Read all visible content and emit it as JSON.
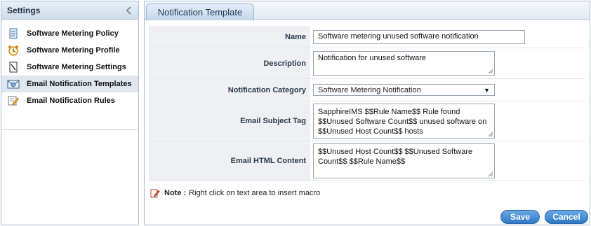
{
  "sidebar": {
    "title": "Settings",
    "collapse_icon": "chevron-left-icon",
    "items": [
      {
        "label": "Software Metering Policy",
        "icon": "policy-document-icon",
        "active": false
      },
      {
        "label": "Software Metering Profile",
        "icon": "alarm-clock-icon",
        "active": false
      },
      {
        "label": "Software Metering Settings",
        "icon": "settings-page-icon",
        "active": false
      },
      {
        "label": "Email Notification Templates",
        "icon": "email-template-icon",
        "active": true
      },
      {
        "label": "Email Notification Rules",
        "icon": "edit-rules-icon",
        "active": false
      }
    ]
  },
  "main": {
    "tab_label": "Notification Template",
    "form": {
      "name_label": "Name",
      "name_value": "Software metering unused software notification",
      "description_label": "Description",
      "description_value": "Notification for unused software",
      "category_label": "Notification Category",
      "category_value": "Software Metering Notification",
      "subject_label": "Email Subject Tag",
      "subject_value": "SapphireIMS  $$Rule Name$$ Rule found $$Unused Software Count$$ unused software on $$Unused Host Count$$ hosts",
      "html_label": "Email HTML Content",
      "html_value": "$$Unused Host Count$$  $$Unused Software Count$$ $$Rule Name$$"
    },
    "note_label": "Note :",
    "note_text": "Right click on text area to insert macro",
    "save_label": "Save",
    "cancel_label": "Cancel"
  },
  "colors": {
    "accent": "#2f78c8",
    "header_bg": "#cfdcea",
    "border": "#a9bfd6",
    "active_item_bg": "#dfe6ee"
  }
}
